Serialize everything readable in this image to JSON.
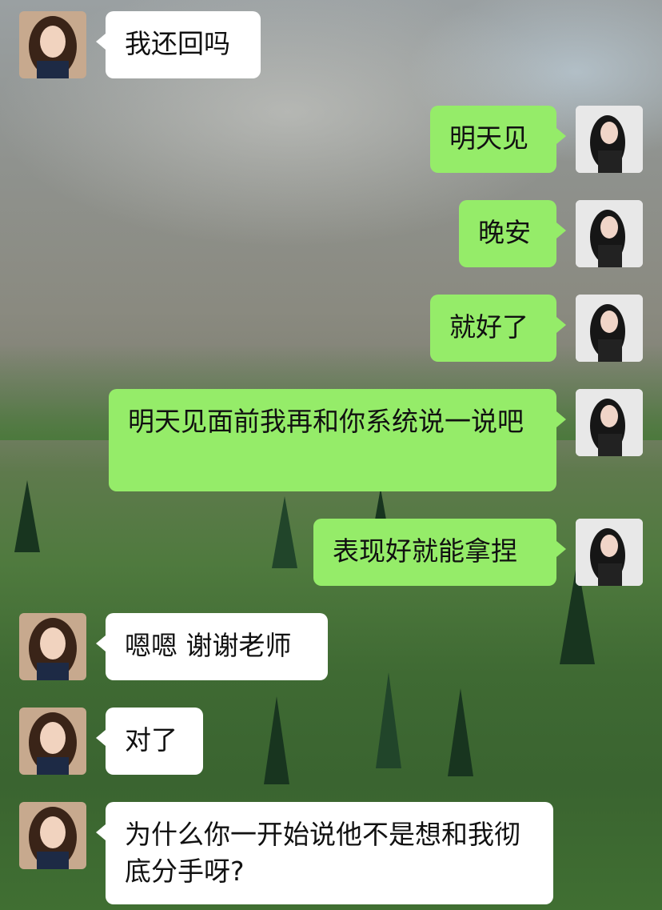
{
  "chat": {
    "messages": [
      {
        "side": "left",
        "text": "我还回吗"
      },
      {
        "side": "right",
        "text": "明天见"
      },
      {
        "side": "right",
        "text": "晚安"
      },
      {
        "side": "right",
        "text": "就好了"
      },
      {
        "side": "right",
        "text": "明天见面前我再和你系统说一说吧"
      },
      {
        "side": "right",
        "text": "表现好就能拿捏"
      },
      {
        "side": "left",
        "text": "嗯嗯 谢谢老师"
      },
      {
        "side": "left",
        "text": "对了"
      },
      {
        "side": "left",
        "text": "为什么你一开始说他不是想和我彻底分手呀?"
      }
    ]
  },
  "colors": {
    "bubble_self": "#95ec69",
    "bubble_other": "#ffffff"
  },
  "icons": {
    "avatar_other": "avatar-woman-light-hair-icon",
    "avatar_self": "avatar-woman-dark-hair-icon"
  }
}
